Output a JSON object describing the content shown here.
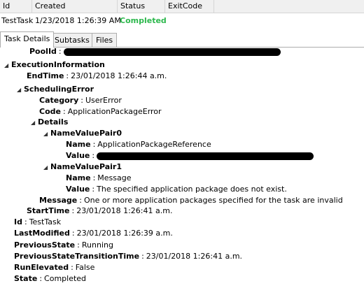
{
  "grid": {
    "columns": [
      "Id",
      "Created",
      "Status",
      "ExitCode"
    ],
    "row": {
      "id": "TestTask",
      "created": "1/23/2018 1:26:39 AM",
      "status": "Completed",
      "exitcode": ""
    }
  },
  "tabs": [
    "Task Details",
    "Subtasks",
    "Files"
  ],
  "tree": {
    "poolid_key": "PoolId",
    "execution_information": "ExecutionInformation",
    "endtime_key": "EndTime",
    "endtime_value": "23/01/2018 1:26:44 a.m.",
    "scheduling_error": "SchedulingError",
    "category_key": "Category",
    "category_value": "UserError",
    "code_key": "Code",
    "code_value": "ApplicationPackageError",
    "details": "Details",
    "nvp0": "NameValuePair0",
    "nvp0_name_key": "Name",
    "nvp0_name_value": "ApplicationPackageReference",
    "nvp0_value_key": "Value",
    "nvp1": "NameValuePair1",
    "nvp1_name_key": "Name",
    "nvp1_name_value": "Message",
    "nvp1_value_key": "Value",
    "nvp1_value_value": "The specified application package does not exist.",
    "message_key": "Message",
    "message_value": "One or more application packages specified for the task are invalid",
    "starttime_key": "StartTime",
    "starttime_value": "23/01/2018 1:26:41 a.m.",
    "id_key": "Id",
    "id_value": "TestTask",
    "lastmodified_key": "LastModified",
    "lastmodified_value": "23/01/2018 1:26:39 a.m.",
    "previousstate_key": "PreviousState",
    "previousstate_value": "Running",
    "prevstatetrans_key": "PreviousStateTransitionTime",
    "prevstatetrans_value": "23/01/2018 1:26:41 a.m.",
    "runelevated_key": "RunElevated",
    "runelevated_value": "False",
    "state_key": "State",
    "state_value": "Completed",
    "colon": ":",
    "expanded_glyph": "◢"
  },
  "colors": {
    "status_completed": "#2db84d",
    "header_bg": "#f0f0f0"
  }
}
